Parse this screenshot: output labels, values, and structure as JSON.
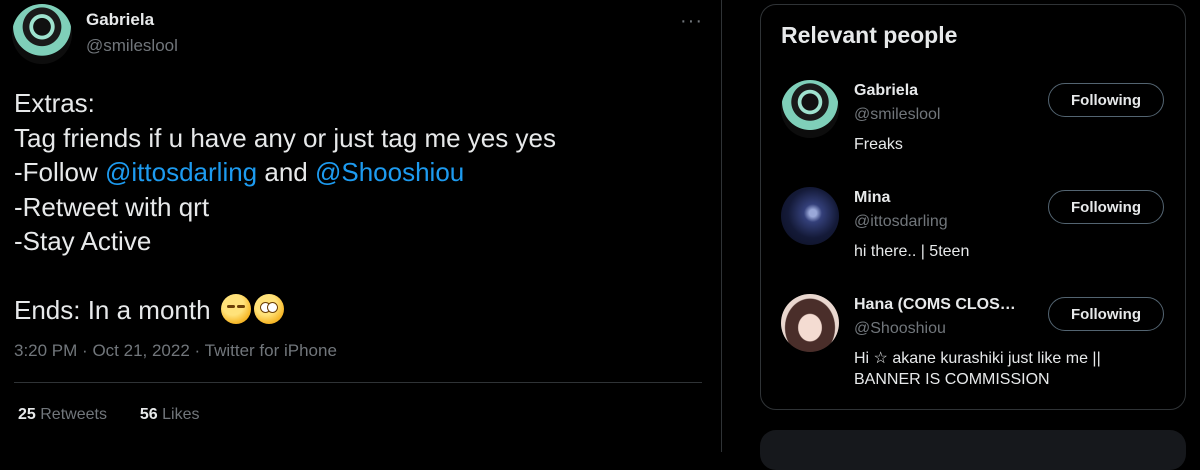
{
  "tweet": {
    "author_name": "Gabriela",
    "author_handle": "@smileslool",
    "more_icon": "more-horizontal-icon",
    "lines": {
      "l1": "Extras:",
      "l2": "Tag friends if u have any or just tag me yes yes",
      "l3_pre": "-Follow ",
      "l3_m1": "@ittosdarling",
      "l3_mid": " and ",
      "l3_m2": "@Shooshiou",
      "l4": "-Retweet with qrt",
      "l5": "-Stay Active",
      "l7": "Ends: In a month "
    },
    "emojis": [
      "unamused-face-emoji",
      "face-with-rolling-eyes-emoji"
    ],
    "time": "3:20 PM",
    "date": "Oct 21, 2022",
    "source": "Twitter for iPhone",
    "sep": "·",
    "retweets_count": "25",
    "retweets_label": "Retweets",
    "likes_count": "56",
    "likes_label": "Likes"
  },
  "relevant_people": {
    "title": "Relevant people",
    "people": [
      {
        "name": "Gabriela",
        "handle": "@smileslool",
        "bio": "Freaks",
        "button": "Following"
      },
      {
        "name": "Mina",
        "handle": "@ittosdarling",
        "bio": "hi there.. | 5teen",
        "button": "Following"
      },
      {
        "name": "Hana (COMS CLOS…",
        "handle": "@Shooshiou",
        "bio": "Hi ☆ akane kurashiki just like me || BANNER IS COMMISSION",
        "button": "Following"
      }
    ]
  },
  "colors": {
    "accent": "#1d9bf0",
    "background": "#000000",
    "text": "#e7e9ea",
    "muted": "#71767b"
  }
}
